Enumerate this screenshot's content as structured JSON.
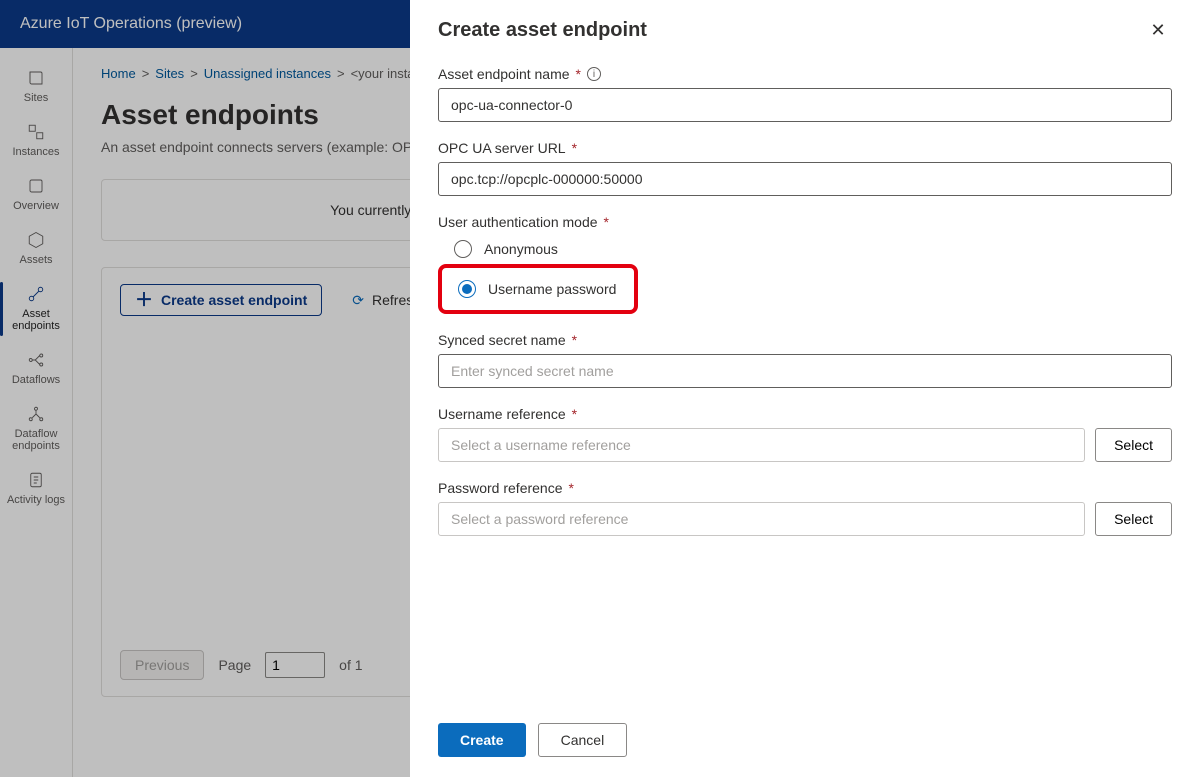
{
  "header": {
    "app_title": "Azure IoT Operations (preview)"
  },
  "sidebar": {
    "items": [
      {
        "label": "Sites"
      },
      {
        "label": "Instances"
      },
      {
        "label": "Overview"
      },
      {
        "label": "Assets"
      },
      {
        "label": "Asset endpoints"
      },
      {
        "label": "Dataflows"
      },
      {
        "label": "Dataflow endpoints"
      },
      {
        "label": "Activity logs"
      }
    ]
  },
  "breadcrumb": {
    "home": "Home",
    "sites": "Sites",
    "unassigned": "Unassigned instances",
    "instance": "<your instance>",
    "sep": ">"
  },
  "page": {
    "title": "Asset endpoints",
    "subtitle": "An asset endpoint connects servers (example: OPC UA) in your environment to Azure IoT Operations.",
    "empty_msg": "You currently do not have any asset endpoints, click on the Create asset endpoints button to begin."
  },
  "toolbar": {
    "create": "Create asset endpoint",
    "refresh": "Refresh"
  },
  "pager": {
    "previous": "Previous",
    "page_label": "Page",
    "page_value": "1",
    "of_label": "of 1"
  },
  "panel": {
    "title": "Create asset endpoint",
    "name_label": "Asset endpoint name",
    "name_value": "opc-ua-connector-0",
    "url_label": "OPC UA server URL",
    "url_value": "opc.tcp://opcplc-000000:50000",
    "auth_label": "User authentication mode",
    "auth_anonymous": "Anonymous",
    "auth_userpass": "Username password",
    "secret_label": "Synced secret name",
    "secret_placeholder": "Enter synced secret name",
    "user_ref_label": "Username reference",
    "user_ref_placeholder": "Select a username reference",
    "pass_ref_label": "Password reference",
    "pass_ref_placeholder": "Select a password reference",
    "select_btn": "Select",
    "create_btn": "Create",
    "cancel_btn": "Cancel"
  }
}
